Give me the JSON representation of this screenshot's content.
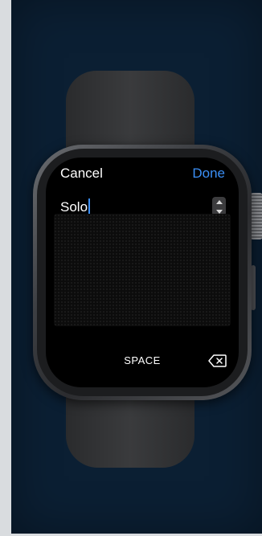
{
  "watch": {
    "header": {
      "cancel_label": "Cancel",
      "done_label": "Done"
    },
    "input": {
      "value": "Solo"
    },
    "keyboard": {
      "space_label": "SPACE"
    },
    "icons": {
      "mode_toggle": "up-down-stepper-icon",
      "delete": "delete-backspace-icon"
    },
    "colors": {
      "accent": "#3b8ff5",
      "background": "#0b1f33",
      "screen": "#000000"
    }
  }
}
